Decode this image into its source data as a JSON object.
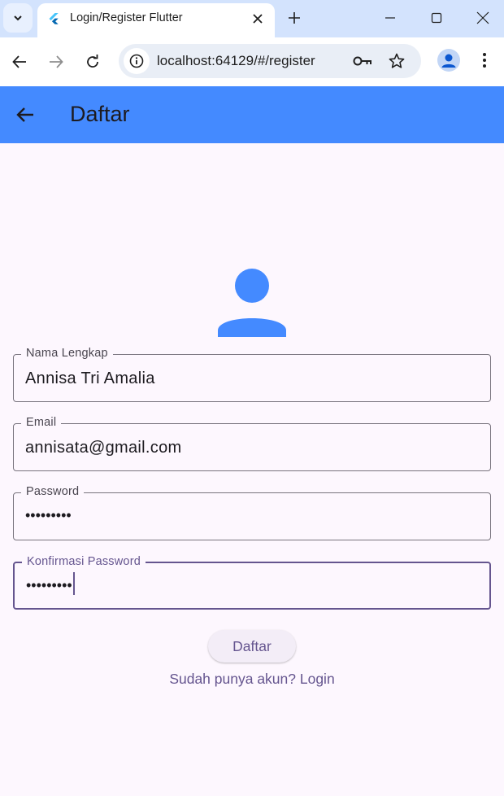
{
  "browser": {
    "tab_title": "Login/Register Flutter",
    "url": "localhost:64129/#/register",
    "icons": {
      "tab_search": "chevron-down-icon",
      "favicon": "flutter-icon",
      "tab_close": "close-icon",
      "new_tab": "plus-icon",
      "minimize": "minimize-icon",
      "maximize": "maximize-icon",
      "close_window": "close-window-icon",
      "back": "arrow-left-icon",
      "forward": "arrow-right-icon",
      "reload": "reload-icon",
      "site_info": "info-icon",
      "password": "key-icon",
      "bookmark": "star-icon",
      "profile": "person-icon",
      "menu": "more-vert-icon"
    }
  },
  "app": {
    "appbar": {
      "title": "Daftar",
      "color": "#448aff"
    },
    "form": {
      "nama": {
        "label": "Nama Lengkap",
        "value": "Annisa Tri Amalia"
      },
      "email": {
        "label": "Email",
        "value": "annisata@gmail.com"
      },
      "password": {
        "label": "Password",
        "value": "•••••••••"
      },
      "konfirmasi": {
        "label": "Konfirmasi Password",
        "value": "•••••••••"
      }
    },
    "submit_label": "Daftar",
    "login_link": "Sudah punya akun? Login",
    "colors": {
      "background": "#fdf7fe",
      "primary": "#65558f",
      "avatar": "#448aff"
    }
  }
}
